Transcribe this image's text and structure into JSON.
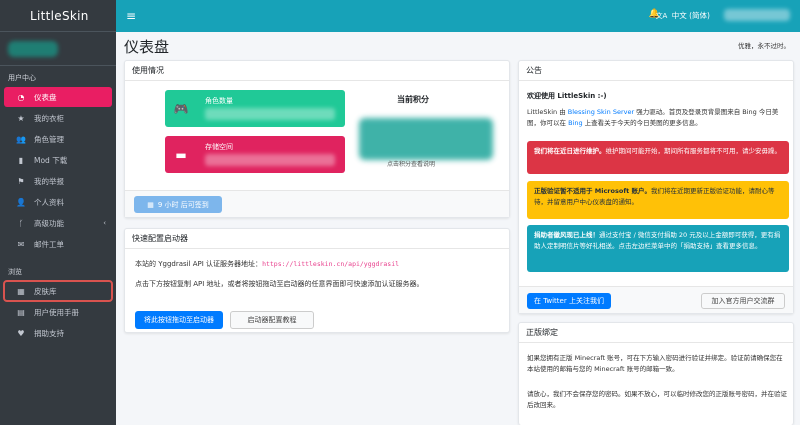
{
  "brand": "LittleSkin",
  "sidebar": {
    "section_user": "用户中心",
    "items": [
      {
        "label": "仪表盘",
        "icon": "dashboard-icon"
      },
      {
        "label": "我的衣柜",
        "icon": "star-icon"
      },
      {
        "label": "角色管理",
        "icon": "users-icon"
      },
      {
        "label": "Mod 下载",
        "icon": "book-icon"
      },
      {
        "label": "我的举报",
        "icon": "flag-icon"
      },
      {
        "label": "个人资料",
        "icon": "user-icon"
      },
      {
        "label": "高级功能",
        "icon": "code-branch-icon"
      },
      {
        "label": "邮件工单",
        "icon": "envelope-icon"
      }
    ],
    "section_browse": "浏览",
    "browse_items": [
      {
        "label": "皮肤库",
        "icon": "skin-library-icon"
      },
      {
        "label": "用户使用手册",
        "icon": "manual-icon"
      },
      {
        "label": "捐助支持",
        "icon": "donate-icon"
      }
    ]
  },
  "topbar": {
    "menu_icon": "≡",
    "bell_icon": "🔔",
    "lang_icon": "文A",
    "language": "中文 (简体)"
  },
  "header": {
    "title": "仪表盘",
    "slogan": "优雅，永不过时。"
  },
  "usage": {
    "title": "使用情况",
    "players_label": "角色数量",
    "storage_label": "存储空间",
    "score_title": "当前积分",
    "score_note": "点击积分查看说明",
    "checkin_label": "9 小时 后可签到"
  },
  "launcher": {
    "title": "快速配置启动器",
    "text1_prefix": "本站的 Yggdrasil API 认证服务器地址：",
    "api_url": "https://littleskin.cn/api/yggdrasil",
    "text2": "点击下方按钮复制 API 地址，或者将按钮拖动至启动器的任意界面即可快速添加认证服务器。",
    "drag_button": "将此按钮拖动至启动器",
    "tutorial_button": "启动器配置教程"
  },
  "notice": {
    "title": "公告",
    "welcome": "欢迎使用 LittleSkin :-)",
    "intro_1": "LittleSkin 由 ",
    "intro_link1": "Blessing Skin Server",
    "intro_2": " 强力驱动。首页及登录页背景图来自 Bing 今日美图，你可以在 ",
    "intro_link2": "Bing",
    "intro_3": " 上查看关于今天的今日美图的更多信息。",
    "alert_red_bold": "我们将在近日进行维护。",
    "alert_red_text": "维护期间可能开始，期间所有服务都将不可用，请少安毋躁。",
    "alert_yellow_bold": "正版验证暂不适用于 Microsoft 账户。",
    "alert_yellow_text": "我们将在近期更新正版验证功能，请耐心等待，并留意用户中心仪表盘的通知。",
    "alert_teal_bold": "捐助者徽风现已上线！",
    "alert_teal_text": "通过支付宝 / 微信支付捐助 20 元及以上金额即可获得，更有捐助人定制明信片等好礼相送。点击左边栏菜单中的「捐助支持」查看更多信息。",
    "twitter_button": "在 Twitter 上关注我们",
    "qq_button": "加入官方用户交流群"
  },
  "bind": {
    "title": "正版绑定",
    "p1": "如果您拥有正版 Minecraft 账号，可在下方输入密码进行验证并绑定。验证前请确保您在本站使用的邮箱与您的 Minecraft 账号的邮箱一致。",
    "p2": "请放心，我们不会保存您的密码。如果不放心，可以临时修改您的正版账号密码，并在验证后改回来。"
  },
  "colors": {
    "sidebar_bg": "#343a40",
    "topbar_bg": "#17a2b8",
    "active_pink": "#e91e63",
    "green": "#20c997",
    "red": "#dc3545",
    "yellow": "#ffc107",
    "primary": "#007bff"
  }
}
